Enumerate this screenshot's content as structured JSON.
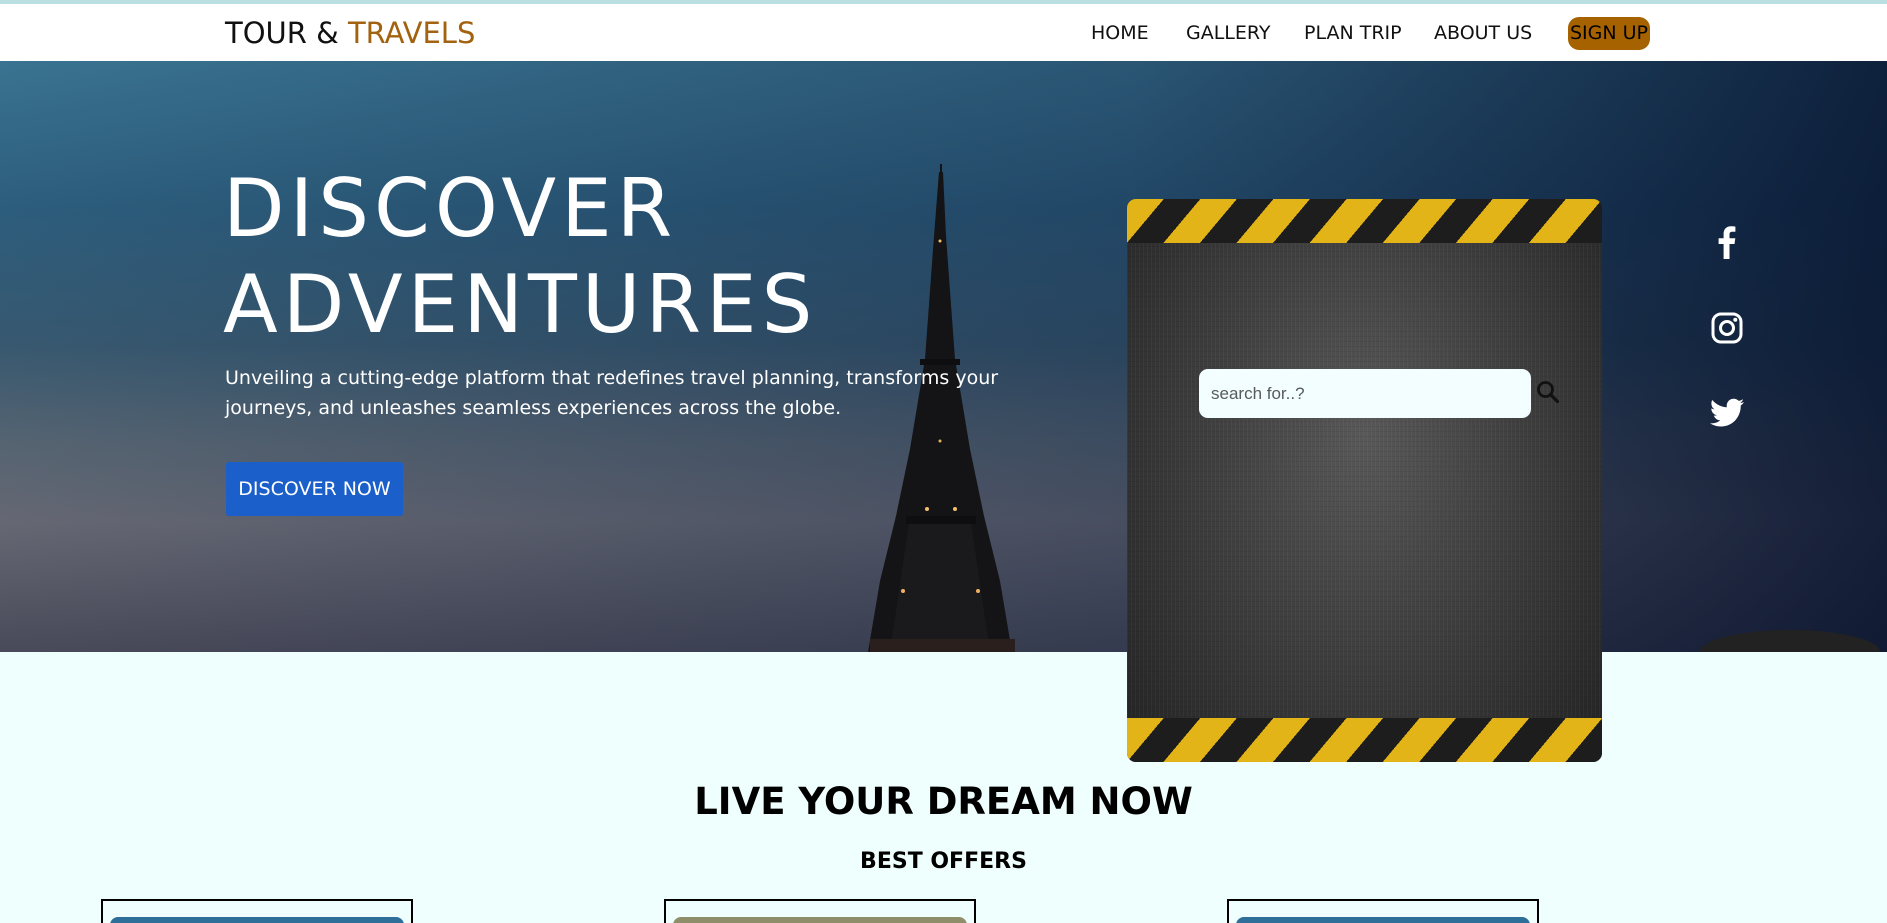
{
  "brand": {
    "part1": "TOUR & ",
    "part2": "TRAVELS",
    "accent_color": "#a2620f"
  },
  "nav": {
    "items": [
      {
        "label": "HOME"
      },
      {
        "label": "GALLERY"
      },
      {
        "label": "PLAN TRIP"
      },
      {
        "label": "ABOUT US"
      }
    ],
    "signup_label": "SIGN UP",
    "signup_color": "#a76200"
  },
  "hero": {
    "title_line1": "DISCOVER",
    "title_line2": "ADVENTURES",
    "description": "Unveiling a cutting-edge platform that redefines travel planning, transforms your journeys, and unleashes seamless experiences across the globe.",
    "cta_label": "DISCOVER NOW",
    "cta_color": "#1a5fca"
  },
  "search": {
    "placeholder": "search for..?",
    "icon": "search-icon"
  },
  "social": {
    "icons": [
      "facebook-icon",
      "instagram-icon",
      "twitter-icon"
    ]
  },
  "offers": {
    "title": "LIVE YOUR DREAM NOW",
    "subtitle": "BEST OFFERS",
    "cards": [
      {
        "image": "offer-image-1"
      },
      {
        "image": "offer-image-2"
      },
      {
        "image": "offer-image-3"
      }
    ]
  }
}
